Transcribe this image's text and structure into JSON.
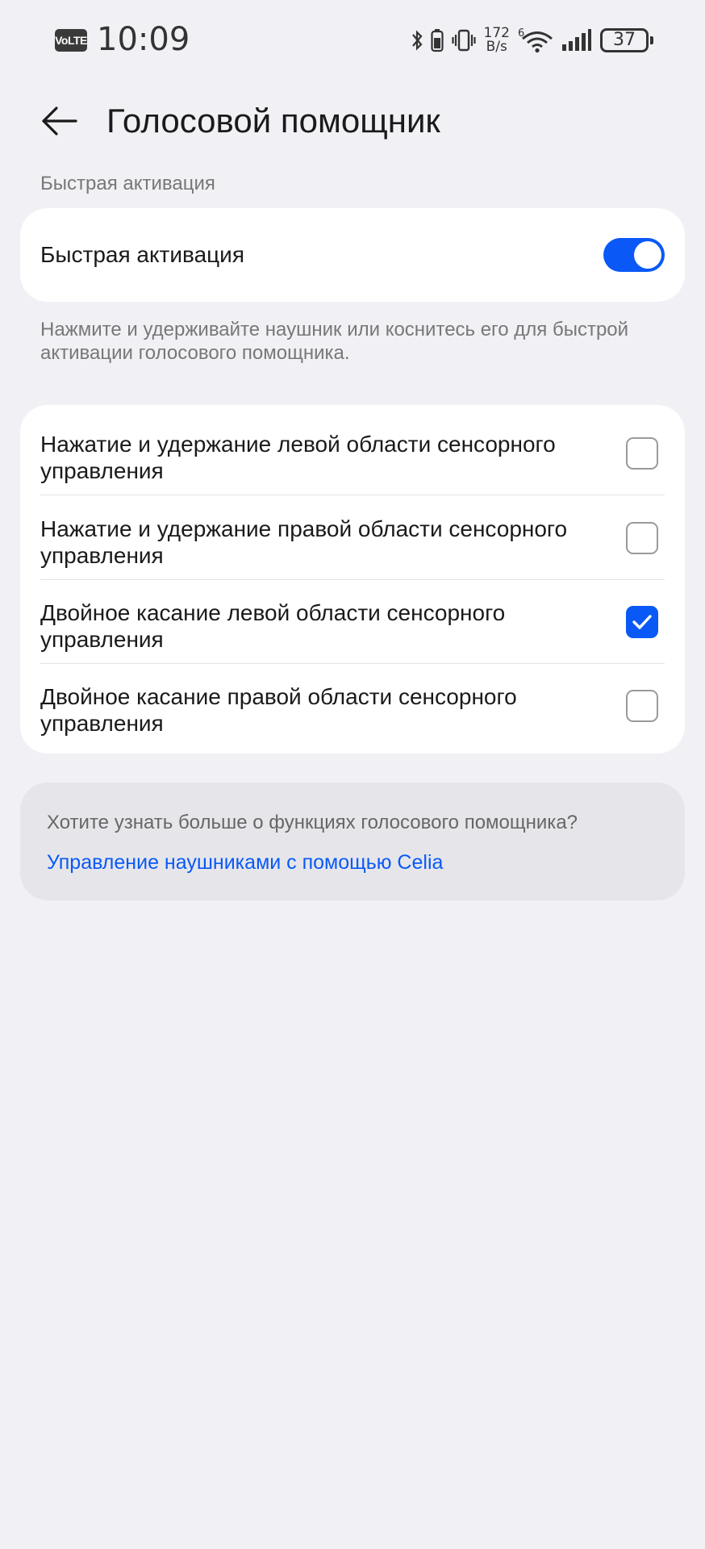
{
  "status_bar": {
    "volte": "VoLTE",
    "time": "10:09",
    "net_speed_value": "172",
    "net_speed_unit": "B/s",
    "wifi_badge": "6",
    "battery": "37"
  },
  "header": {
    "title": "Голосовой помощник"
  },
  "quick_activation": {
    "section_label": "Быстрая активация",
    "toggle_label": "Быстрая активация",
    "toggle_on": true,
    "description": "Нажмите и удерживайте наушник или коснитесь его для быстрой активации голосового помощника."
  },
  "options": [
    {
      "label": "Нажатие и удержание левой области сенсорного управления",
      "checked": false
    },
    {
      "label": "Нажатие и удержание правой области сенсорного управления",
      "checked": false
    },
    {
      "label": "Двойное касание левой области сенсорного управления",
      "checked": true
    },
    {
      "label": "Двойное касание правой области сенсорного управления",
      "checked": false
    }
  ],
  "info": {
    "question": "Хотите узнать больше о функциях голосового помощника?",
    "link": "Управление наушниками с помощью Celia"
  },
  "colors": {
    "accent": "#0a59f7",
    "background": "#f1f1f5",
    "card": "#ffffff"
  }
}
